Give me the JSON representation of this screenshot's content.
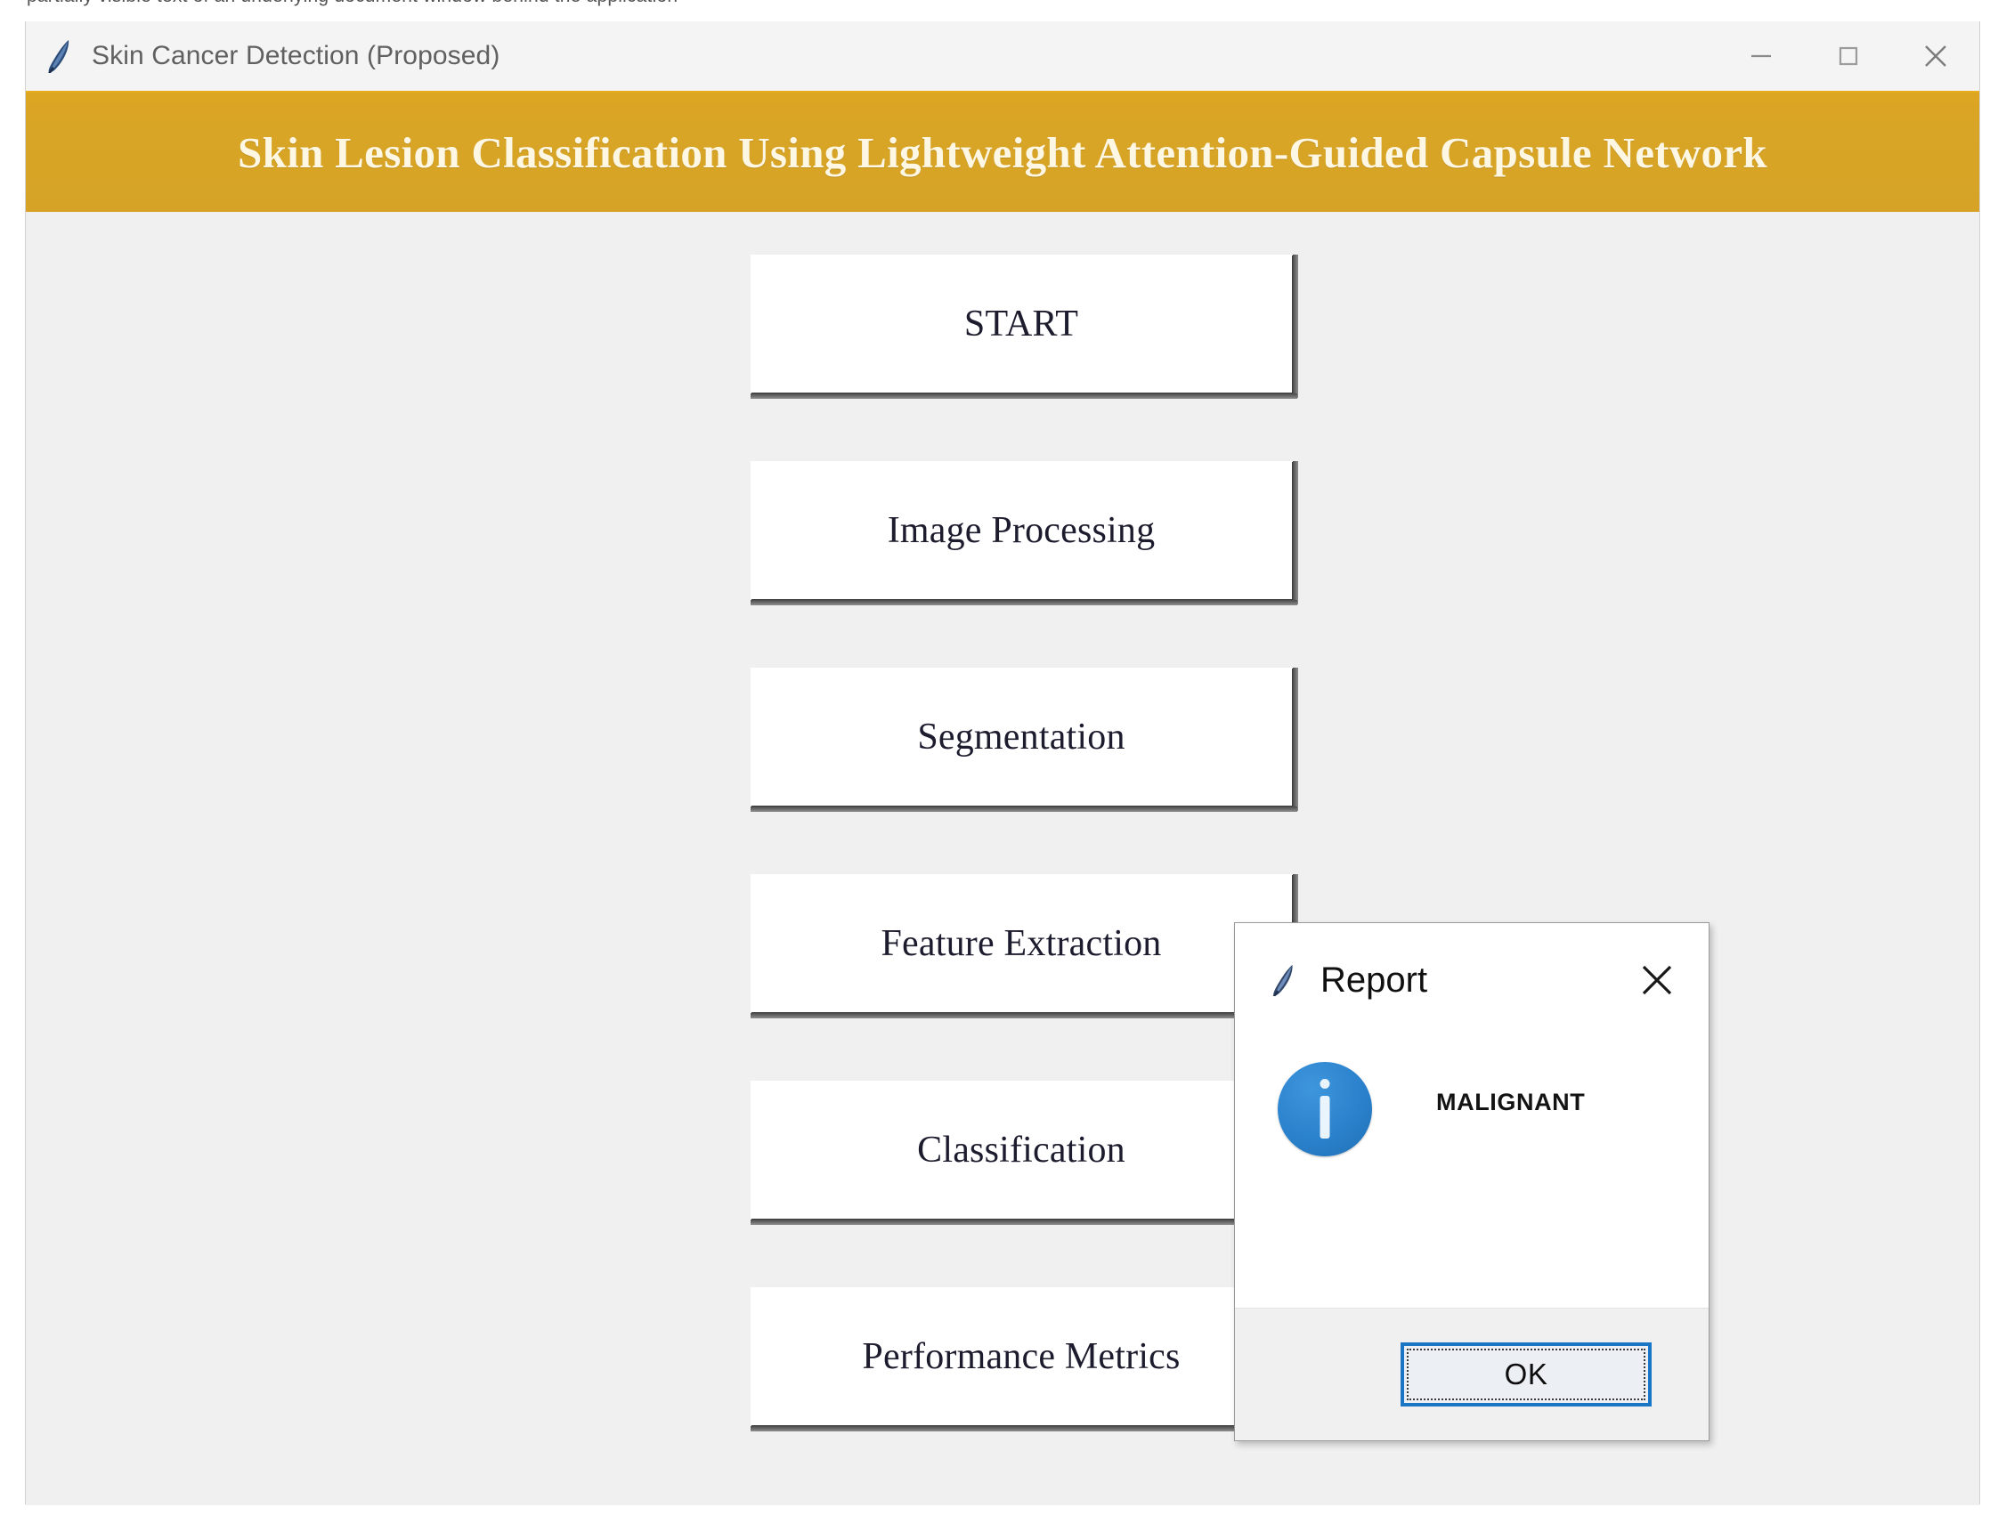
{
  "background_window": {
    "sliver_text": "partially visible text of an underlying document window behind the application"
  },
  "window": {
    "title": "Skin Cancer Detection (Proposed)",
    "icon": "feather-icon",
    "controls": {
      "minimize": "minimize-icon",
      "maximize": "maximize-icon",
      "close": "close-icon"
    }
  },
  "banner": {
    "title": "Skin Lesion Classification Using Lightweight Attention-Guided Capsule Network",
    "background_color": "#D8A526",
    "text_color": "#FDF7E4"
  },
  "buttons": [
    {
      "label": "START"
    },
    {
      "label": "Image Processing"
    },
    {
      "label": "Segmentation"
    },
    {
      "label": "Feature Extraction"
    },
    {
      "label": "Classification"
    },
    {
      "label": "Performance Metrics"
    }
  ],
  "dialog": {
    "title": "Report",
    "icon": "feather-icon",
    "close_icon": "close-icon",
    "info_icon": "info-circle-icon",
    "message": "MALIGNANT",
    "ok_label": "OK",
    "accent_color": "#1A76C4",
    "info_icon_color": "#2B82CC"
  }
}
